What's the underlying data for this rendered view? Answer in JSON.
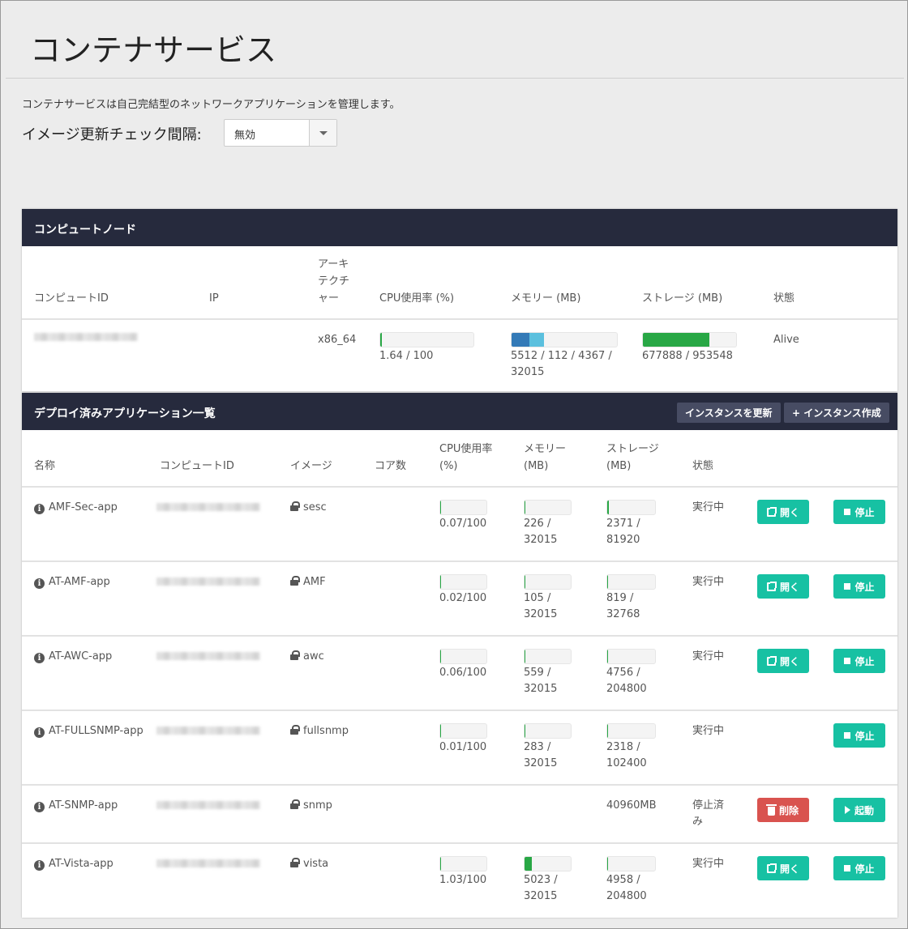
{
  "page": {
    "title": "コンテナサービス",
    "description": "コンテナサービスは自己完結型のネットワークアプリケーションを管理します。",
    "interval_label": "イメージ更新チェック間隔:",
    "interval_value": "無効"
  },
  "nodes_panel": {
    "title": "コンピュートノード",
    "headers": {
      "compute_id": "コンピュートID",
      "ip": "IP",
      "arch": "アーキテクチャー",
      "cpu": "CPU使用率 (%)",
      "memory": "メモリー (MB)",
      "storage": "ストレージ (MB)",
      "status": "状態"
    },
    "rows": [
      {
        "arch": "x86_64",
        "cpu_text": "1.64 / 100",
        "cpu_pct": 1.64,
        "memory_text": "5512 / 112 / 4367 / 32015",
        "memory_segments_pct": [
          17.2,
          13.6
        ],
        "storage_text": "677888 / 953548",
        "storage_pct": 71.1,
        "status": "Alive"
      }
    ]
  },
  "apps_panel": {
    "title": "デプロイ済みアプリケーション一覧",
    "refresh_button": "インスタンスを更新",
    "create_button": "+ インスタンス作成",
    "headers": {
      "name": "名称",
      "compute_id": "コンピュートID",
      "image": "イメージ",
      "cores": "コア数",
      "cpu": "CPU使用率 (%)",
      "memory": "メモリー (MB)",
      "storage": "ストレージ (MB)",
      "status": "状態"
    },
    "rows": [
      {
        "name": "AMF-Sec-app",
        "image": "sesc",
        "cpu_text": "0.07/100",
        "cpu_pct": 0.07,
        "mem_text": "226 / 32015",
        "mem_pct": 0.7,
        "sto_text": "2371 / 81920",
        "sto_pct": 2.9,
        "status": "実行中",
        "open_label": "開く",
        "action_label": "停止"
      },
      {
        "name": "AT-AMF-app",
        "image": "AMF",
        "cpu_text": "0.02/100",
        "cpu_pct": 0.02,
        "mem_text": "105 / 32015",
        "mem_pct": 0.3,
        "sto_text": "819 / 32768",
        "sto_pct": 2.5,
        "status": "実行中",
        "open_label": "開く",
        "action_label": "停止"
      },
      {
        "name": "AT-AWC-app",
        "image": "awc",
        "cpu_text": "0.06/100",
        "cpu_pct": 0.06,
        "mem_text": "559 / 32015",
        "mem_pct": 1.7,
        "sto_text": "4756 / 204800",
        "sto_pct": 2.3,
        "status": "実行中",
        "open_label": "開く",
        "action_label": "停止"
      },
      {
        "name": "AT-FULLSNMP-app",
        "image": "fullsnmp",
        "cpu_text": "0.01/100",
        "cpu_pct": 0.01,
        "mem_text": "283 / 32015",
        "mem_pct": 0.9,
        "sto_text": "2318 / 102400",
        "sto_pct": 2.3,
        "status": "実行中",
        "open_label": "",
        "action_label": "停止"
      },
      {
        "name": "AT-SNMP-app",
        "image": "snmp",
        "cpu_text": "",
        "cpu_pct": null,
        "mem_text": "",
        "mem_pct": null,
        "sto_text": "40960MB",
        "sto_pct": null,
        "status": "停止済み",
        "delete_label": "削除",
        "action_label": "起動"
      },
      {
        "name": "AT-Vista-app",
        "image": "vista",
        "cpu_text": "1.03/100",
        "cpu_pct": 1.03,
        "mem_text": "5023 / 32015",
        "mem_pct": 15.7,
        "sto_text": "4958 / 204800",
        "sto_pct": 2.4,
        "status": "実行中",
        "open_label": "開く",
        "action_label": "停止"
      }
    ]
  },
  "colors": {
    "header_bg": "#262a3d",
    "teal": "#17c1a3",
    "red": "#d9534f",
    "green": "#28a745",
    "blue_dark": "#337ab7",
    "blue_light": "#5bc0de"
  }
}
